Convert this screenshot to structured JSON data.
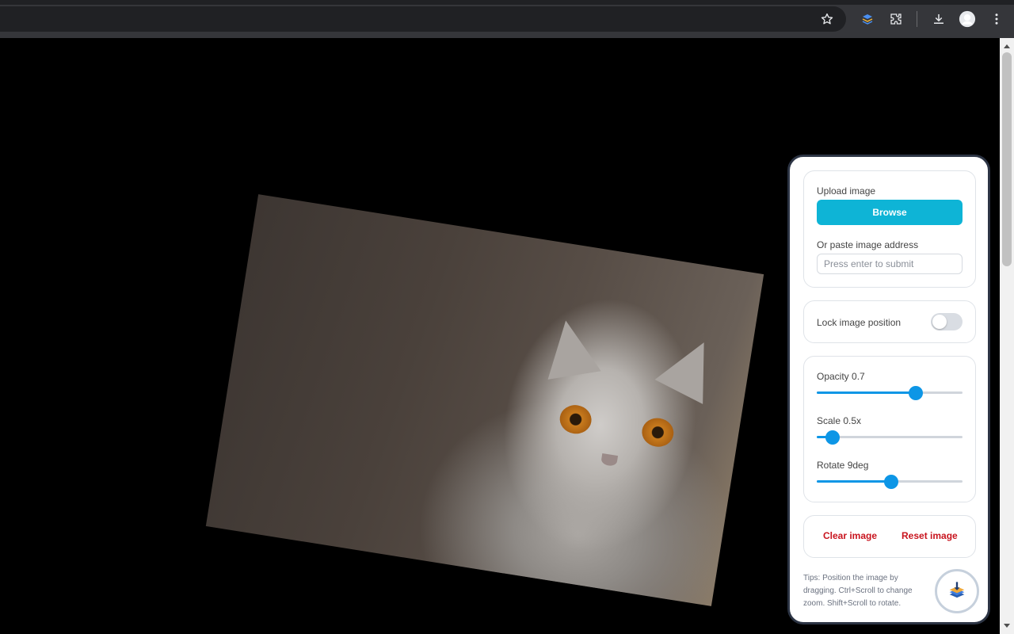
{
  "browser": {
    "toolbar_icons": [
      "star-icon",
      "extension-layers-icon",
      "puzzle-icon",
      "download-icon",
      "profile-avatar",
      "more-vert-icon"
    ]
  },
  "panel": {
    "upload": {
      "label": "Upload image",
      "browse_button": "Browse",
      "paste_label": "Or paste image address",
      "input_placeholder": "Press enter to submit",
      "input_value": ""
    },
    "lock": {
      "label": "Lock image position",
      "enabled": false
    },
    "sliders": {
      "opacity": {
        "label": "Opacity 0.7",
        "value": 0.7,
        "fill": 0.68
      },
      "scale": {
        "label": "Scale 0.5x",
        "value": 0.5,
        "fill": 0.11
      },
      "rotate": {
        "label": "Rotate 9deg",
        "value": 9,
        "fill": 0.51
      }
    },
    "actions": {
      "clear": "Clear image",
      "reset": "Reset image"
    },
    "tips": "Tips: Position the image by dragging. Ctrl+Scroll to change zoom. Shift+Scroll to rotate.",
    "fab_icon": "layers-icon"
  },
  "colors": {
    "accent": "#0eb4d6",
    "slider": "#0d96e6",
    "danger": "#c8141e",
    "panel_border": "#2c3444"
  }
}
